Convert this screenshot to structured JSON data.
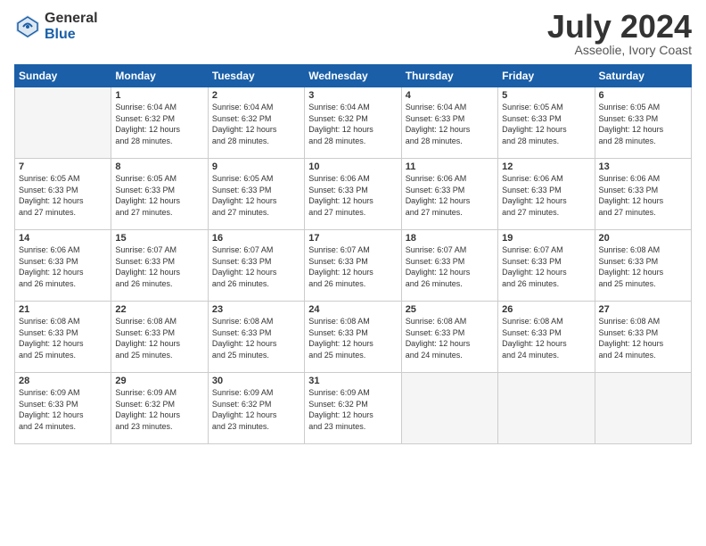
{
  "header": {
    "logo_general": "General",
    "logo_blue": "Blue",
    "month_year": "July 2024",
    "location": "Asseolie, Ivory Coast"
  },
  "days_of_week": [
    "Sunday",
    "Monday",
    "Tuesday",
    "Wednesday",
    "Thursday",
    "Friday",
    "Saturday"
  ],
  "weeks": [
    [
      {
        "day": "",
        "info": ""
      },
      {
        "day": "1",
        "info": "Sunrise: 6:04 AM\nSunset: 6:32 PM\nDaylight: 12 hours\nand 28 minutes."
      },
      {
        "day": "2",
        "info": "Sunrise: 6:04 AM\nSunset: 6:32 PM\nDaylight: 12 hours\nand 28 minutes."
      },
      {
        "day": "3",
        "info": "Sunrise: 6:04 AM\nSunset: 6:32 PM\nDaylight: 12 hours\nand 28 minutes."
      },
      {
        "day": "4",
        "info": "Sunrise: 6:04 AM\nSunset: 6:33 PM\nDaylight: 12 hours\nand 28 minutes."
      },
      {
        "day": "5",
        "info": "Sunrise: 6:05 AM\nSunset: 6:33 PM\nDaylight: 12 hours\nand 28 minutes."
      },
      {
        "day": "6",
        "info": "Sunrise: 6:05 AM\nSunset: 6:33 PM\nDaylight: 12 hours\nand 28 minutes."
      }
    ],
    [
      {
        "day": "7",
        "info": "Sunrise: 6:05 AM\nSunset: 6:33 PM\nDaylight: 12 hours\nand 27 minutes."
      },
      {
        "day": "8",
        "info": "Sunrise: 6:05 AM\nSunset: 6:33 PM\nDaylight: 12 hours\nand 27 minutes."
      },
      {
        "day": "9",
        "info": "Sunrise: 6:05 AM\nSunset: 6:33 PM\nDaylight: 12 hours\nand 27 minutes."
      },
      {
        "day": "10",
        "info": "Sunrise: 6:06 AM\nSunset: 6:33 PM\nDaylight: 12 hours\nand 27 minutes."
      },
      {
        "day": "11",
        "info": "Sunrise: 6:06 AM\nSunset: 6:33 PM\nDaylight: 12 hours\nand 27 minutes."
      },
      {
        "day": "12",
        "info": "Sunrise: 6:06 AM\nSunset: 6:33 PM\nDaylight: 12 hours\nand 27 minutes."
      },
      {
        "day": "13",
        "info": "Sunrise: 6:06 AM\nSunset: 6:33 PM\nDaylight: 12 hours\nand 27 minutes."
      }
    ],
    [
      {
        "day": "14",
        "info": "Sunrise: 6:06 AM\nSunset: 6:33 PM\nDaylight: 12 hours\nand 26 minutes."
      },
      {
        "day": "15",
        "info": "Sunrise: 6:07 AM\nSunset: 6:33 PM\nDaylight: 12 hours\nand 26 minutes."
      },
      {
        "day": "16",
        "info": "Sunrise: 6:07 AM\nSunset: 6:33 PM\nDaylight: 12 hours\nand 26 minutes."
      },
      {
        "day": "17",
        "info": "Sunrise: 6:07 AM\nSunset: 6:33 PM\nDaylight: 12 hours\nand 26 minutes."
      },
      {
        "day": "18",
        "info": "Sunrise: 6:07 AM\nSunset: 6:33 PM\nDaylight: 12 hours\nand 26 minutes."
      },
      {
        "day": "19",
        "info": "Sunrise: 6:07 AM\nSunset: 6:33 PM\nDaylight: 12 hours\nand 26 minutes."
      },
      {
        "day": "20",
        "info": "Sunrise: 6:08 AM\nSunset: 6:33 PM\nDaylight: 12 hours\nand 25 minutes."
      }
    ],
    [
      {
        "day": "21",
        "info": "Sunrise: 6:08 AM\nSunset: 6:33 PM\nDaylight: 12 hours\nand 25 minutes."
      },
      {
        "day": "22",
        "info": "Sunrise: 6:08 AM\nSunset: 6:33 PM\nDaylight: 12 hours\nand 25 minutes."
      },
      {
        "day": "23",
        "info": "Sunrise: 6:08 AM\nSunset: 6:33 PM\nDaylight: 12 hours\nand 25 minutes."
      },
      {
        "day": "24",
        "info": "Sunrise: 6:08 AM\nSunset: 6:33 PM\nDaylight: 12 hours\nand 25 minutes."
      },
      {
        "day": "25",
        "info": "Sunrise: 6:08 AM\nSunset: 6:33 PM\nDaylight: 12 hours\nand 24 minutes."
      },
      {
        "day": "26",
        "info": "Sunrise: 6:08 AM\nSunset: 6:33 PM\nDaylight: 12 hours\nand 24 minutes."
      },
      {
        "day": "27",
        "info": "Sunrise: 6:08 AM\nSunset: 6:33 PM\nDaylight: 12 hours\nand 24 minutes."
      }
    ],
    [
      {
        "day": "28",
        "info": "Sunrise: 6:09 AM\nSunset: 6:33 PM\nDaylight: 12 hours\nand 24 minutes."
      },
      {
        "day": "29",
        "info": "Sunrise: 6:09 AM\nSunset: 6:32 PM\nDaylight: 12 hours\nand 23 minutes."
      },
      {
        "day": "30",
        "info": "Sunrise: 6:09 AM\nSunset: 6:32 PM\nDaylight: 12 hours\nand 23 minutes."
      },
      {
        "day": "31",
        "info": "Sunrise: 6:09 AM\nSunset: 6:32 PM\nDaylight: 12 hours\nand 23 minutes."
      },
      {
        "day": "",
        "info": ""
      },
      {
        "day": "",
        "info": ""
      },
      {
        "day": "",
        "info": ""
      }
    ]
  ]
}
